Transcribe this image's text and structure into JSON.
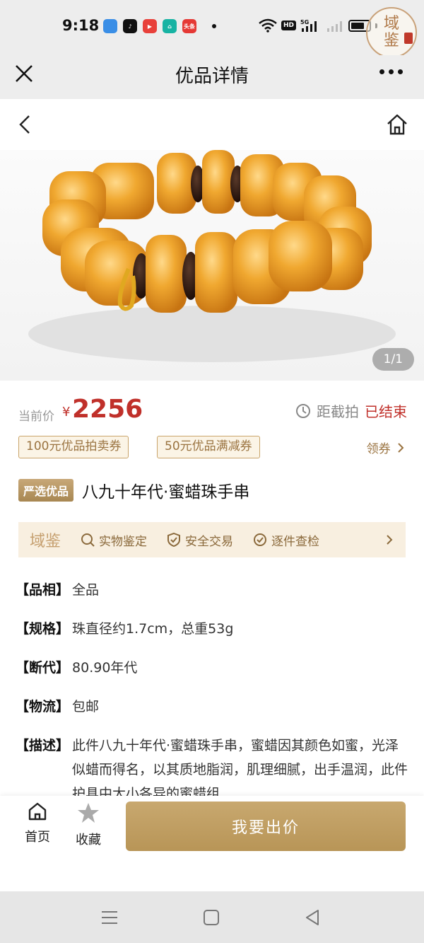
{
  "status_bar": {
    "time": "9:18",
    "app_icons": [
      "cloud-app-icon",
      "tiktok-app-icon",
      "video-app-icon",
      "home-app-icon",
      "toutiao-app-icon"
    ],
    "toutiao_label": "头条",
    "network": "5G",
    "hd": "HD"
  },
  "watermark": {
    "text_top": "域",
    "text_bottom": "鉴"
  },
  "title_bar": {
    "title": "优品详情"
  },
  "image": {
    "counter": "1/1"
  },
  "price": {
    "label": "当前价",
    "currency": "¥",
    "value": "2256",
    "deadline_label": "距截拍",
    "deadline_status": "已结束"
  },
  "coupons": {
    "items": [
      "100元优品拍卖券",
      "50元优品满减券"
    ],
    "link_label": "领券"
  },
  "product": {
    "badge": "严选优品",
    "title": "八九十年代·蜜蜡珠手串"
  },
  "services": {
    "brand": "域鉴",
    "items": [
      "实物鉴定",
      "安全交易",
      "逐件查检"
    ]
  },
  "specs": [
    {
      "key": "【品相】",
      "value": "全品"
    },
    {
      "key": "【规格】",
      "value": "珠直径约1.7cm，总重53g"
    },
    {
      "key": "【断代】",
      "value": "80.90年代"
    },
    {
      "key": "【物流】",
      "value": "包邮"
    },
    {
      "key": "【描述】",
      "value": "此件八九十年代·蜜蜡珠手串，蜜蜡因其颜色如蜜，光泽似蜡而得名，以其质地脂润，肌理细腻，出手温润，此件护具中大小各异的蜜蜡组"
    }
  ],
  "action_bar": {
    "home_label": "首页",
    "favorite_label": "收藏",
    "bid_label": "我要出价"
  },
  "colors": {
    "price_red": "#c0302a",
    "gold": "#b89557",
    "coupon_border": "#c9a46a",
    "service_bg": "#f8efe0"
  }
}
